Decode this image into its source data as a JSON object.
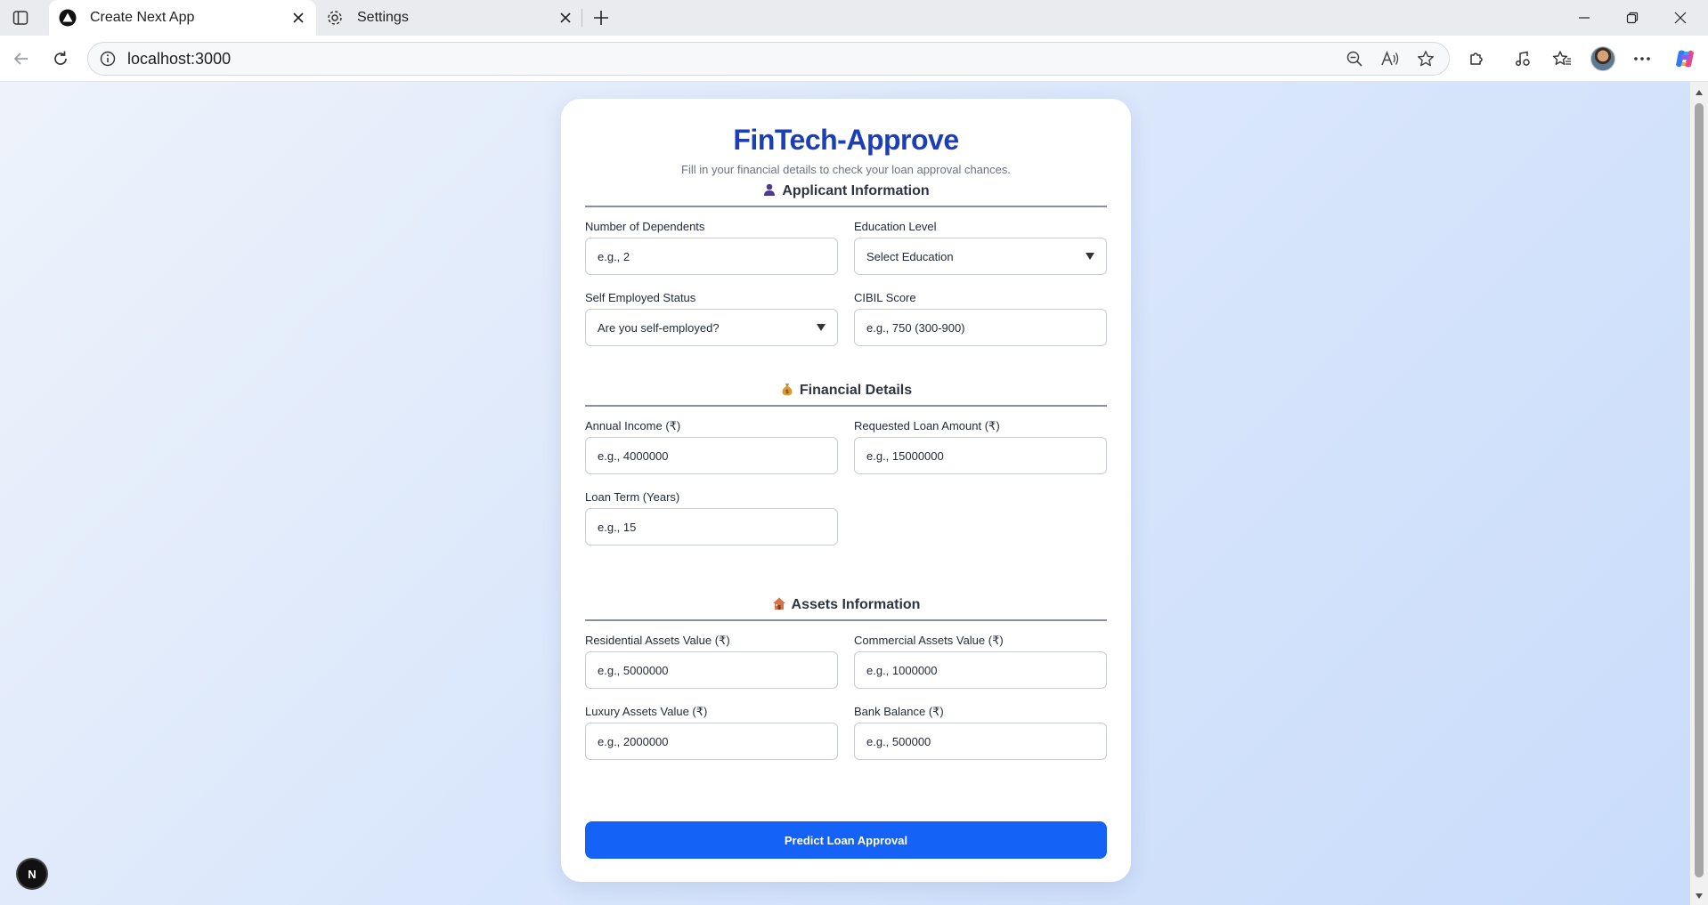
{
  "browser": {
    "tabs": [
      {
        "title": "Create Next App",
        "active": true,
        "icon": "nextjs-icon"
      },
      {
        "title": "Settings",
        "active": false,
        "icon": "gear-icon"
      }
    ],
    "url": "localhost:3000"
  },
  "colors": {
    "brand_title": "#1d3fb5",
    "primary_button": "#1563f6",
    "page_gradient_start": "#eef3fb",
    "page_gradient_end": "#c9dcfb"
  },
  "form": {
    "title": "FinTech-Approve",
    "subtitle": "Fill in your financial details to check your loan approval chances.",
    "sections": {
      "applicant": {
        "heading": "Applicant Information",
        "icon": "person-icon",
        "fields": {
          "dependents": {
            "label": "Number of Dependents",
            "placeholder": "e.g., 2"
          },
          "education": {
            "label": "Education Level",
            "selected": "Select Education"
          },
          "self_employed": {
            "label": "Self Employed Status",
            "selected": "Are you self-employed?"
          },
          "cibil": {
            "label": "CIBIL Score",
            "placeholder": "e.g., 750 (300-900)"
          }
        }
      },
      "financial": {
        "heading": "Financial Details",
        "icon": "money-bag-icon",
        "fields": {
          "income": {
            "label": "Annual Income (₹)",
            "placeholder": "e.g., 4000000"
          },
          "loan_amount": {
            "label": "Requested Loan Amount (₹)",
            "placeholder": "e.g., 15000000"
          },
          "loan_term": {
            "label": "Loan Term (Years)",
            "placeholder": "e.g., 15"
          }
        }
      },
      "assets": {
        "heading": "Assets Information",
        "icon": "house-icon",
        "fields": {
          "residential": {
            "label": "Residential Assets Value (₹)",
            "placeholder": "e.g., 5000000"
          },
          "commercial": {
            "label": "Commercial Assets Value (₹)",
            "placeholder": "e.g., 1000000"
          },
          "luxury": {
            "label": "Luxury Assets Value (₹)",
            "placeholder": "e.g., 2000000"
          },
          "bank_balance": {
            "label": "Bank Balance (₹)",
            "placeholder": "e.g., 500000"
          }
        }
      }
    },
    "submit_label": "Predict Loan Approval"
  },
  "dev_badge": {
    "label": "N"
  }
}
